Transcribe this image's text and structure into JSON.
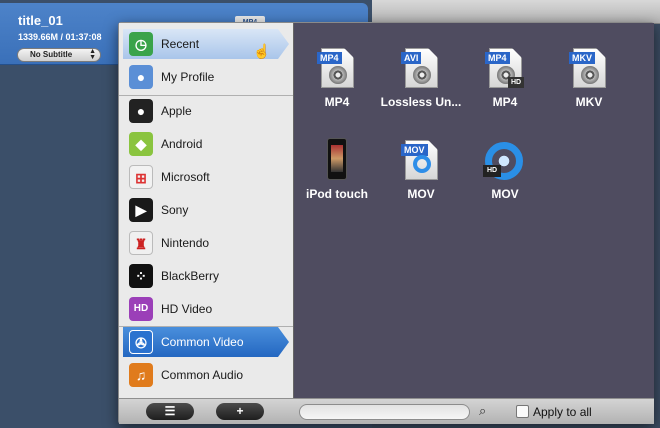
{
  "title_item": {
    "name": "title_01",
    "meta": "1339.66M / 01:37:08",
    "subtitle_value": "No Subtitle",
    "badge": "MP4"
  },
  "sidebar": {
    "items": [
      {
        "label": "Recent",
        "icon": "clock-icon",
        "color": "#3aa34a"
      },
      {
        "label": "My Profile",
        "icon": "profile-icon",
        "color": "#5b8fd6"
      },
      {
        "label": "Apple",
        "icon": "apple-icon",
        "color": "#222222"
      },
      {
        "label": "Android",
        "icon": "android-icon",
        "color": "#8ac43f"
      },
      {
        "label": "Microsoft",
        "icon": "windows-icon",
        "color": "#f2f2f2"
      },
      {
        "label": "Sony",
        "icon": "playstation-icon",
        "color": "#1a1a1a"
      },
      {
        "label": "Nintendo",
        "icon": "mario-icon",
        "color": "#f0f0f0"
      },
      {
        "label": "BlackBerry",
        "icon": "blackberry-icon",
        "color": "#111111"
      },
      {
        "label": "HD Video",
        "icon": "hd-video-icon",
        "color": "#9b3fb8"
      },
      {
        "label": "Common Video",
        "icon": "film-reel-icon",
        "color": "#2a72cf"
      },
      {
        "label": "Common Audio",
        "icon": "music-note-icon",
        "color": "#e07b1c"
      }
    ]
  },
  "formats": [
    {
      "name": "MP4",
      "tag": "MP4",
      "icon": "mp4-file-icon"
    },
    {
      "name": "Lossless Un...",
      "tag": "AVI",
      "icon": "avi-file-icon"
    },
    {
      "name": "MP4",
      "tag": "MP4",
      "icon": "mp4-hd-file-icon",
      "hd": "HD"
    },
    {
      "name": "MKV",
      "tag": "MKV",
      "icon": "mkv-file-icon"
    },
    {
      "name": "iPod touch",
      "tag": "",
      "icon": "ipod-touch-icon"
    },
    {
      "name": "MOV",
      "tag": "MOV",
      "icon": "mov-file-icon"
    },
    {
      "name": "MOV",
      "tag": "",
      "icon": "quicktime-hd-icon",
      "hd": "HD"
    }
  ],
  "bottom_bar": {
    "list_button": "☰",
    "add_button": "+",
    "search_placeholder": "",
    "apply_label": "Apply to all"
  }
}
